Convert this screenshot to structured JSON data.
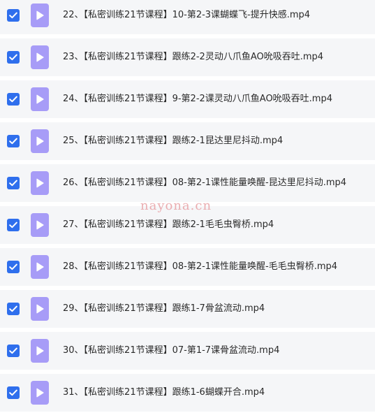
{
  "files": [
    {
      "name": "22、【私密训练21节课程】10-第2-3课蝴蝶飞-提升快感.mp4",
      "checked": true
    },
    {
      "name": "23、【私密训练21节课程】跟练2-2灵动八爪鱼AO吮吸吞吐.mp4",
      "checked": true
    },
    {
      "name": "24、【私密训练21节课程】9-第2-2课灵动八爪鱼AO吮吸吞吐.mp4",
      "checked": true
    },
    {
      "name": "25、【私密训练21节课程】跟练2-1昆达里尼抖动.mp4",
      "checked": true
    },
    {
      "name": "26、【私密训练21节课程】08-第2-1课性能量唤醒-昆达里尼抖动.mp4",
      "checked": true
    },
    {
      "name": "27、【私密训练21节课程】跟练2-1毛毛虫臀桥.mp4",
      "checked": true
    },
    {
      "name": "28、【私密训练21节课程】08-第2-1课性能量唤醒-毛毛虫臀桥.mp4",
      "checked": true
    },
    {
      "name": "29、【私密训练21节课程】跟练1-7骨盆流动.mp4",
      "checked": true
    },
    {
      "name": "30、【私密训练21节课程】07-第1-7课骨盆流动.mp4",
      "checked": true
    },
    {
      "name": "31、【私密训练21节课程】跟练1-6蝴蝶开合.mp4",
      "checked": true
    }
  ],
  "watermark": "nayona.cn",
  "colors": {
    "checkbox": "#2f6fed",
    "file_icon": "#a79cf7",
    "row_background": "#f5f6f8",
    "watermark": "#e8a0a4"
  },
  "icons": {
    "checkbox": "checkmark-icon",
    "file": "video-file-icon"
  }
}
